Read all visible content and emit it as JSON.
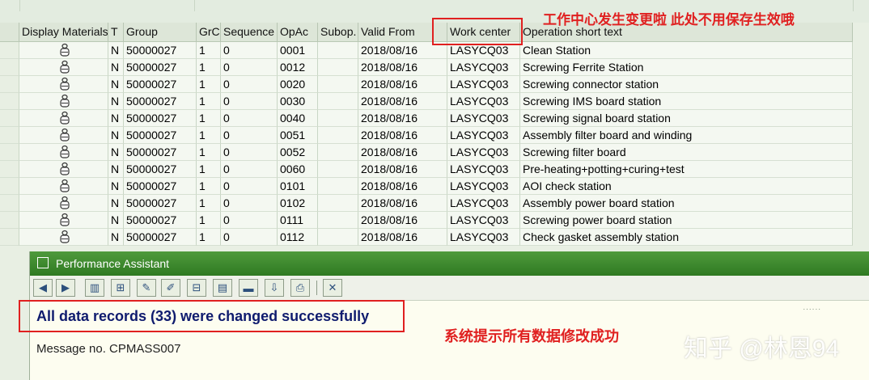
{
  "columns": [
    "Display Materials",
    "T",
    "Group",
    "GrC",
    "Sequence",
    "OpAc",
    "Subop.",
    "Valid From",
    "Work center",
    "Operation short text"
  ],
  "rows": [
    {
      "t": "N",
      "group": "50000027",
      "grc": "1",
      "seq": "0",
      "opac": "0001",
      "subop": "",
      "valid": "2018/08/16",
      "wc": "LASYCQ03",
      "text": "Clean Station"
    },
    {
      "t": "N",
      "group": "50000027",
      "grc": "1",
      "seq": "0",
      "opac": "0012",
      "subop": "",
      "valid": "2018/08/16",
      "wc": "LASYCQ03",
      "text": "Screwing Ferrite Station"
    },
    {
      "t": "N",
      "group": "50000027",
      "grc": "1",
      "seq": "0",
      "opac": "0020",
      "subop": "",
      "valid": "2018/08/16",
      "wc": "LASYCQ03",
      "text": "Screwing connector station"
    },
    {
      "t": "N",
      "group": "50000027",
      "grc": "1",
      "seq": "0",
      "opac": "0030",
      "subop": "",
      "valid": "2018/08/16",
      "wc": "LASYCQ03",
      "text": "Screwing IMS board station"
    },
    {
      "t": "N",
      "group": "50000027",
      "grc": "1",
      "seq": "0",
      "opac": "0040",
      "subop": "",
      "valid": "2018/08/16",
      "wc": "LASYCQ03",
      "text": "Screwing signal board station"
    },
    {
      "t": "N",
      "group": "50000027",
      "grc": "1",
      "seq": "0",
      "opac": "0051",
      "subop": "",
      "valid": "2018/08/16",
      "wc": "LASYCQ03",
      "text": "Assembly filter board and winding"
    },
    {
      "t": "N",
      "group": "50000027",
      "grc": "1",
      "seq": "0",
      "opac": "0052",
      "subop": "",
      "valid": "2018/08/16",
      "wc": "LASYCQ03",
      "text": "Screwing filter board"
    },
    {
      "t": "N",
      "group": "50000027",
      "grc": "1",
      "seq": "0",
      "opac": "0060",
      "subop": "",
      "valid": "2018/08/16",
      "wc": "LASYCQ03",
      "text": "Pre-heating+potting+curing+test"
    },
    {
      "t": "N",
      "group": "50000027",
      "grc": "1",
      "seq": "0",
      "opac": "0101",
      "subop": "",
      "valid": "2018/08/16",
      "wc": "LASYCQ03",
      "text": "AOI check station"
    },
    {
      "t": "N",
      "group": "50000027",
      "grc": "1",
      "seq": "0",
      "opac": "0102",
      "subop": "",
      "valid": "2018/08/16",
      "wc": "LASYCQ03",
      "text": "Assembly power board station"
    },
    {
      "t": "N",
      "group": "50000027",
      "grc": "1",
      "seq": "0",
      "opac": "0111",
      "subop": "",
      "valid": "2018/08/16",
      "wc": "LASYCQ03",
      "text": "Screwing power board station"
    },
    {
      "t": "N",
      "group": "50000027",
      "grc": "1",
      "seq": "0",
      "opac": "0112",
      "subop": "",
      "valid": "2018/08/16",
      "wc": "LASYCQ03",
      "text": "Check gasket assembly station"
    }
  ],
  "annotations": {
    "top": "工作中心发生变更啦 此处不用保存生效哦",
    "bottom": "系统提示所有数据修改成功"
  },
  "assistant": {
    "title": "Performance Assistant",
    "message": "All data records (33) were changed successfully",
    "message_no": "Message no. CPMASS007"
  },
  "watermark": "知乎 @林恩94",
  "colors": {
    "annotation_red": "#e02020",
    "title_green": "#3f8a2f",
    "message_blue": "#0f1b6e"
  }
}
